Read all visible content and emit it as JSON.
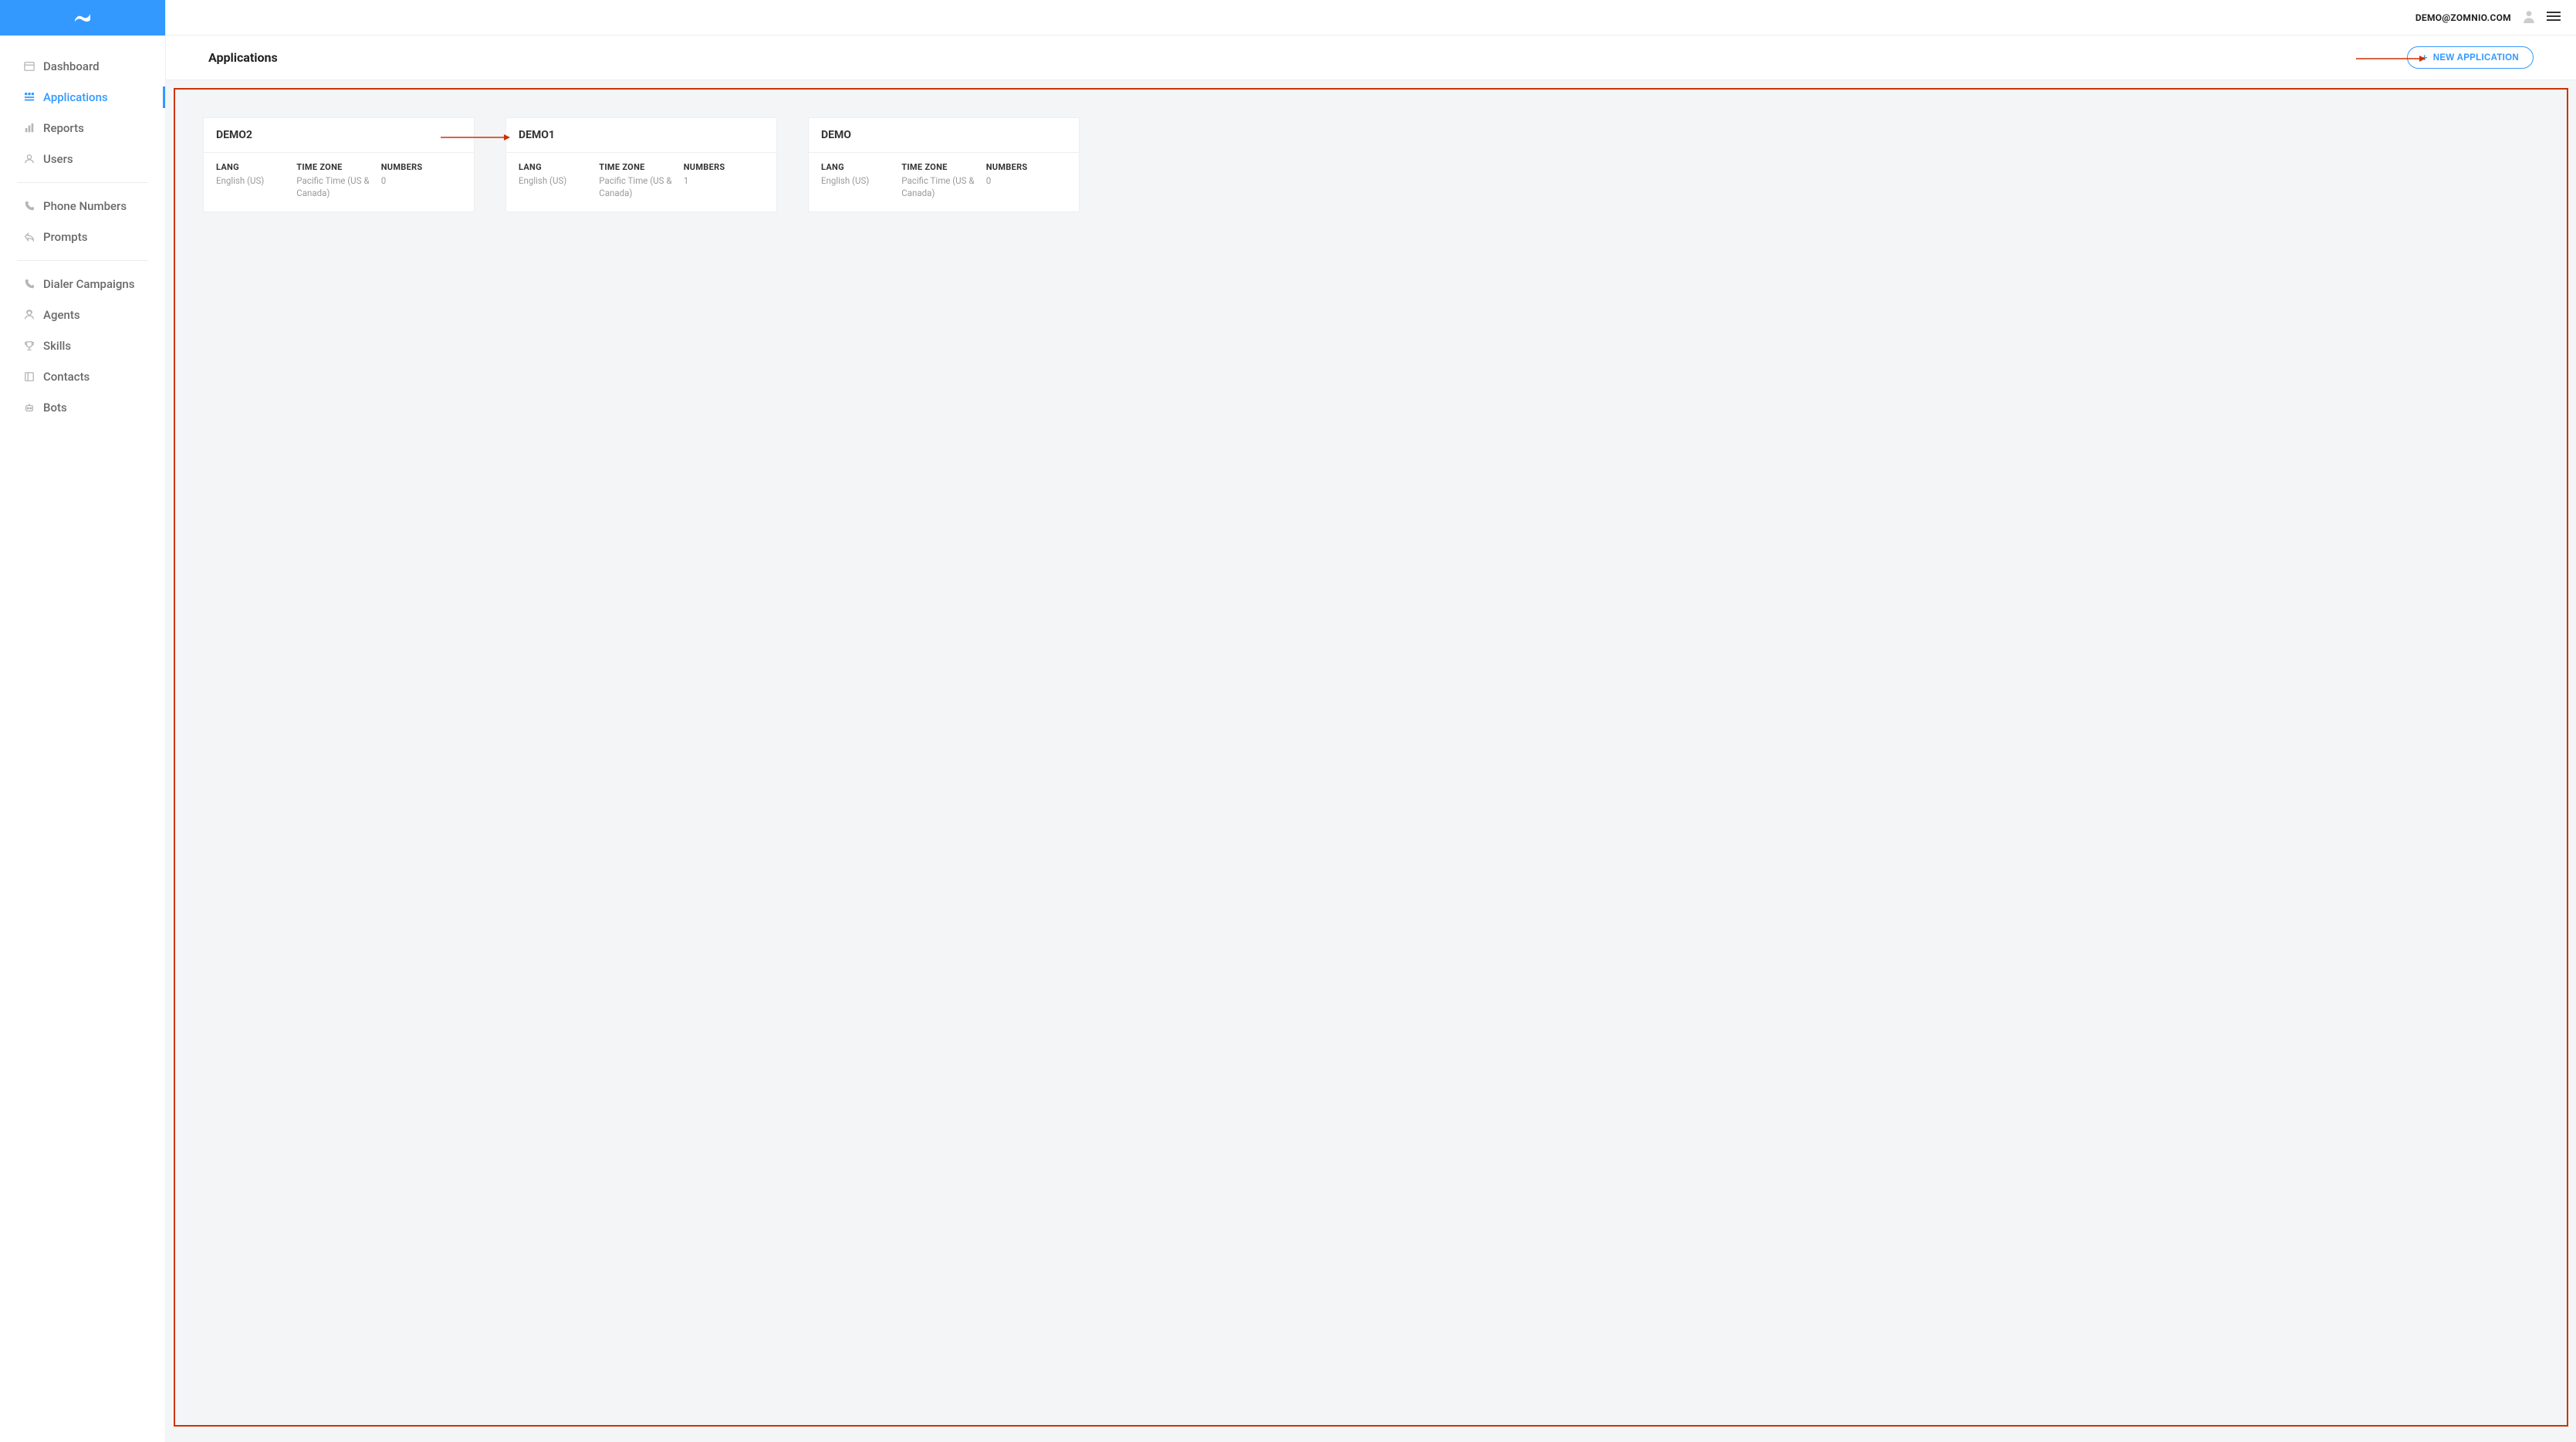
{
  "header": {
    "email": "DEMO@ZOMNIO.COM"
  },
  "page": {
    "title": "Applications",
    "new_button_label": "NEW APPLICATION"
  },
  "sidebar": {
    "items": [
      {
        "label": "Dashboard"
      },
      {
        "label": "Applications"
      },
      {
        "label": "Reports"
      },
      {
        "label": "Users"
      },
      {
        "label": "Phone Numbers"
      },
      {
        "label": "Prompts"
      },
      {
        "label": "Dialer Campaigns"
      },
      {
        "label": "Agents"
      },
      {
        "label": "Skills"
      },
      {
        "label": "Contacts"
      },
      {
        "label": "Bots"
      }
    ]
  },
  "card_labels": {
    "lang": "LANG",
    "timezone": "TIME ZONE",
    "numbers": "NUMBERS"
  },
  "applications": [
    {
      "name": "DEMO2",
      "lang": "English (US)",
      "timezone": "Pacific Time (US & Canada)",
      "numbers": "0"
    },
    {
      "name": "DEMO1",
      "lang": "English (US)",
      "timezone": "Pacific Time (US & Canada)",
      "numbers": "1"
    },
    {
      "name": "DEMO",
      "lang": "English (US)",
      "timezone": "Pacific Time (US & Canada)",
      "numbers": "0"
    }
  ]
}
